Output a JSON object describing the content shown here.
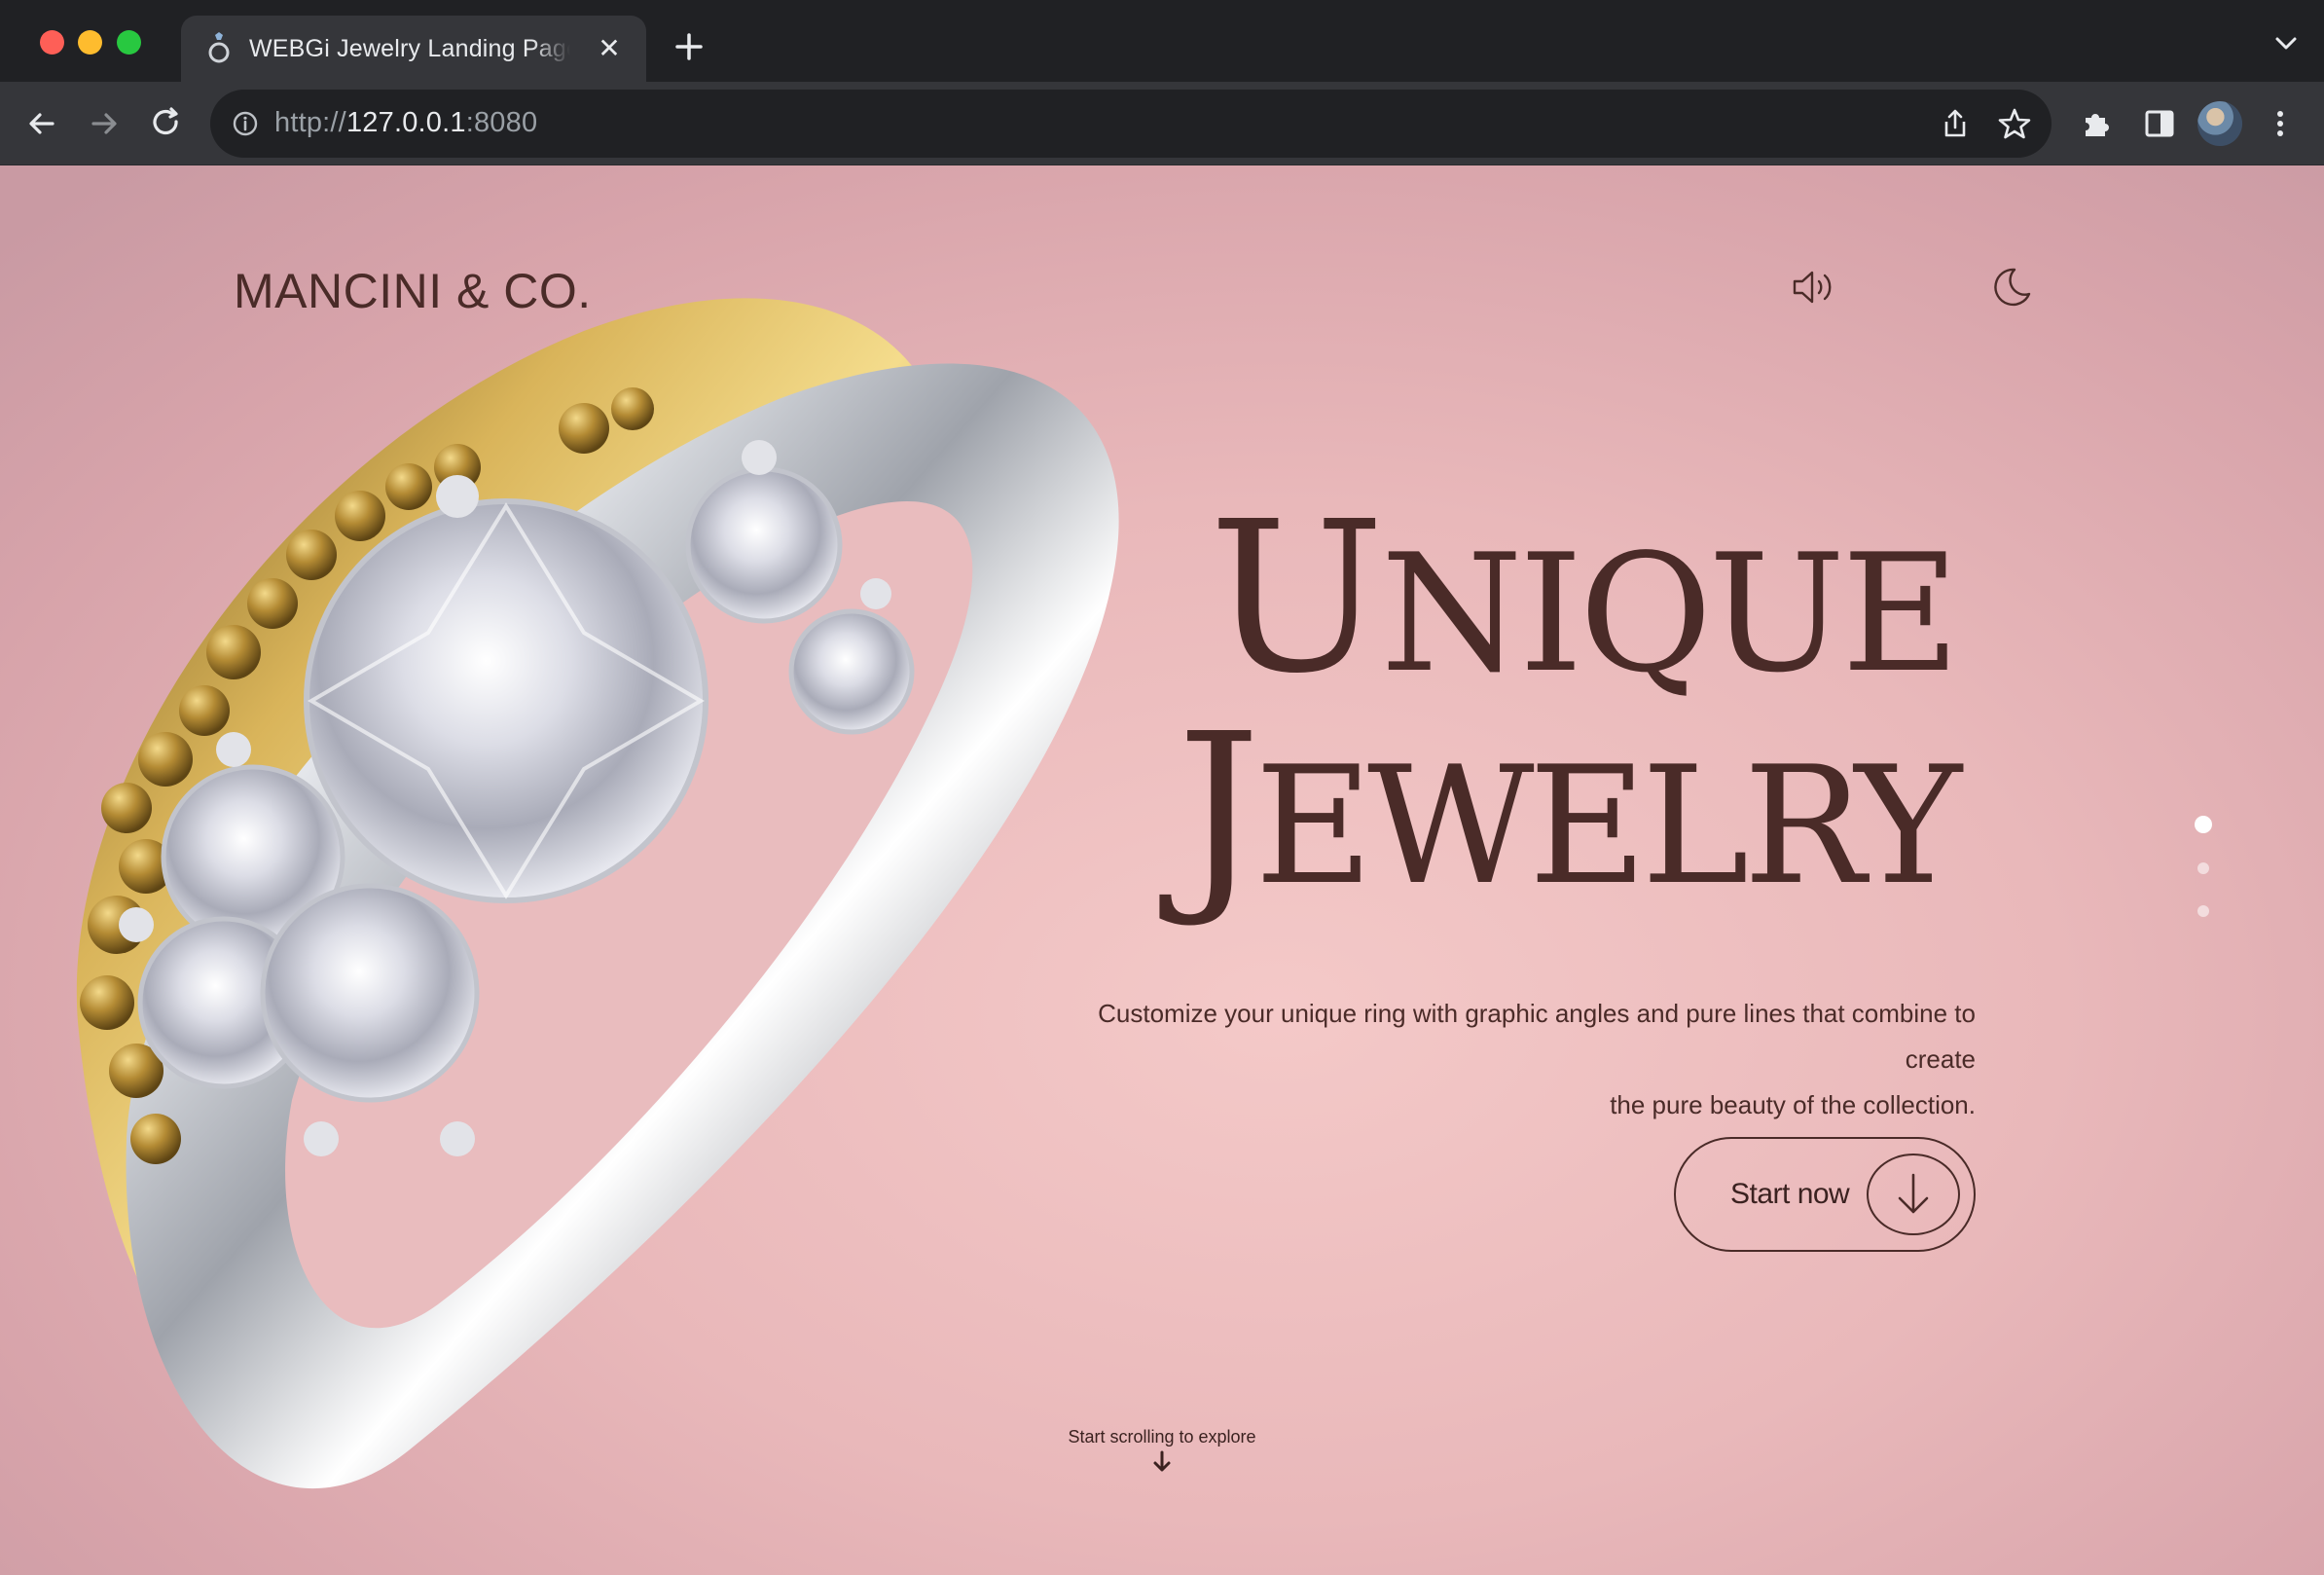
{
  "browser": {
    "tab_title": "WEBGi Jewelry Landing Page | Mancini & Co.",
    "url_scheme": "http://",
    "url_host": "127.0.0.1",
    "url_port": ":8080",
    "close_glyph": "✕",
    "icons": [
      "ring-favicon-icon",
      "close-icon",
      "plus-icon",
      "chevron-down-icon",
      "back-arrow-icon",
      "forward-arrow-icon",
      "reload-icon",
      "info-icon",
      "share-icon",
      "star-icon",
      "puzzle-icon",
      "sidebar-icon",
      "avatar",
      "kebab-menu-icon"
    ]
  },
  "page": {
    "brand": "MANCINI & CO.",
    "headline": {
      "line1_initial": "U",
      "line1_rest": "NIQUE",
      "line2_initial": "J",
      "line2_rest": "EWELRY"
    },
    "description_line1": "Customize your unique ring with graphic angles and pure lines that combine to create",
    "description_line2": "the pure beauty of the collection.",
    "cta_label": "Start now",
    "scroll_hint": "Start scrolling to explore",
    "pagination": {
      "count": 3,
      "active_index": 0
    },
    "icons": [
      "speaker-icon",
      "moon-icon",
      "arrow-down-circle-icon",
      "arrow-down-icon"
    ]
  },
  "colors": {
    "text_brown": "#4a2b28",
    "background_pink": "#f4c9c8",
    "chrome_dark": "#202124",
    "chrome_tab": "#35363a"
  }
}
